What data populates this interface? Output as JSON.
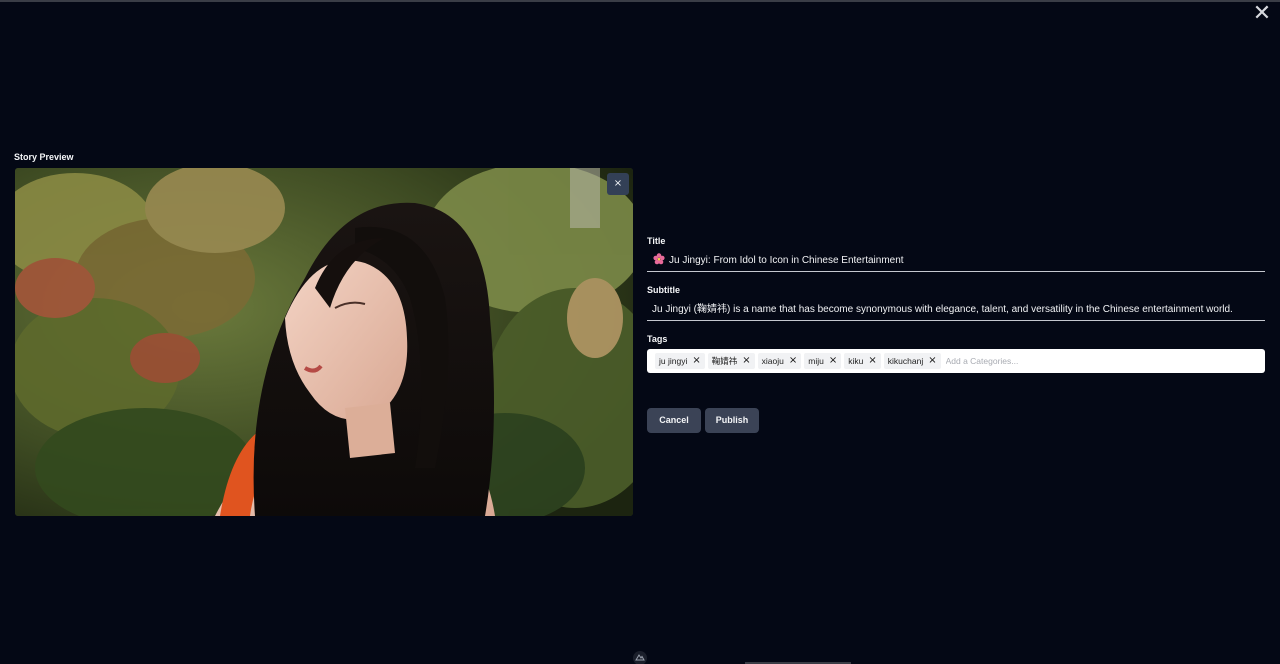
{
  "modal": {
    "close_icon": "close-icon"
  },
  "preview": {
    "label": "Story Preview",
    "image_alt": "Portrait of a woman with long dark hair among green and red leaves",
    "remove_symbol": "×"
  },
  "form": {
    "title_label": "Title",
    "title_value": "Ju Jingyi: From Idol to Icon in Chinese Entertainment",
    "title_icon": "cherry-blossom-icon",
    "subtitle_label": "Subtitle",
    "subtitle_value": "Ju Jingyi (鞠婧祎) is a name that has become synonymous with elegance, talent, and versatility in the Chinese entertainment world.",
    "tags_label": "Tags",
    "tags": [
      {
        "label": "ju jingyi"
      },
      {
        "label": "鞠婧祎"
      },
      {
        "label": "xiaoju"
      },
      {
        "label": "miju"
      },
      {
        "label": "kiku"
      },
      {
        "label": "kikuchanj"
      }
    ],
    "tag_remove_symbol": "×",
    "tags_placeholder": "Add a Categories..."
  },
  "actions": {
    "cancel_label": "Cancel",
    "publish_label": "Publish"
  },
  "colors": {
    "background": "#040815",
    "button": "#3b4356",
    "accent_flower": "#e86a9a"
  }
}
